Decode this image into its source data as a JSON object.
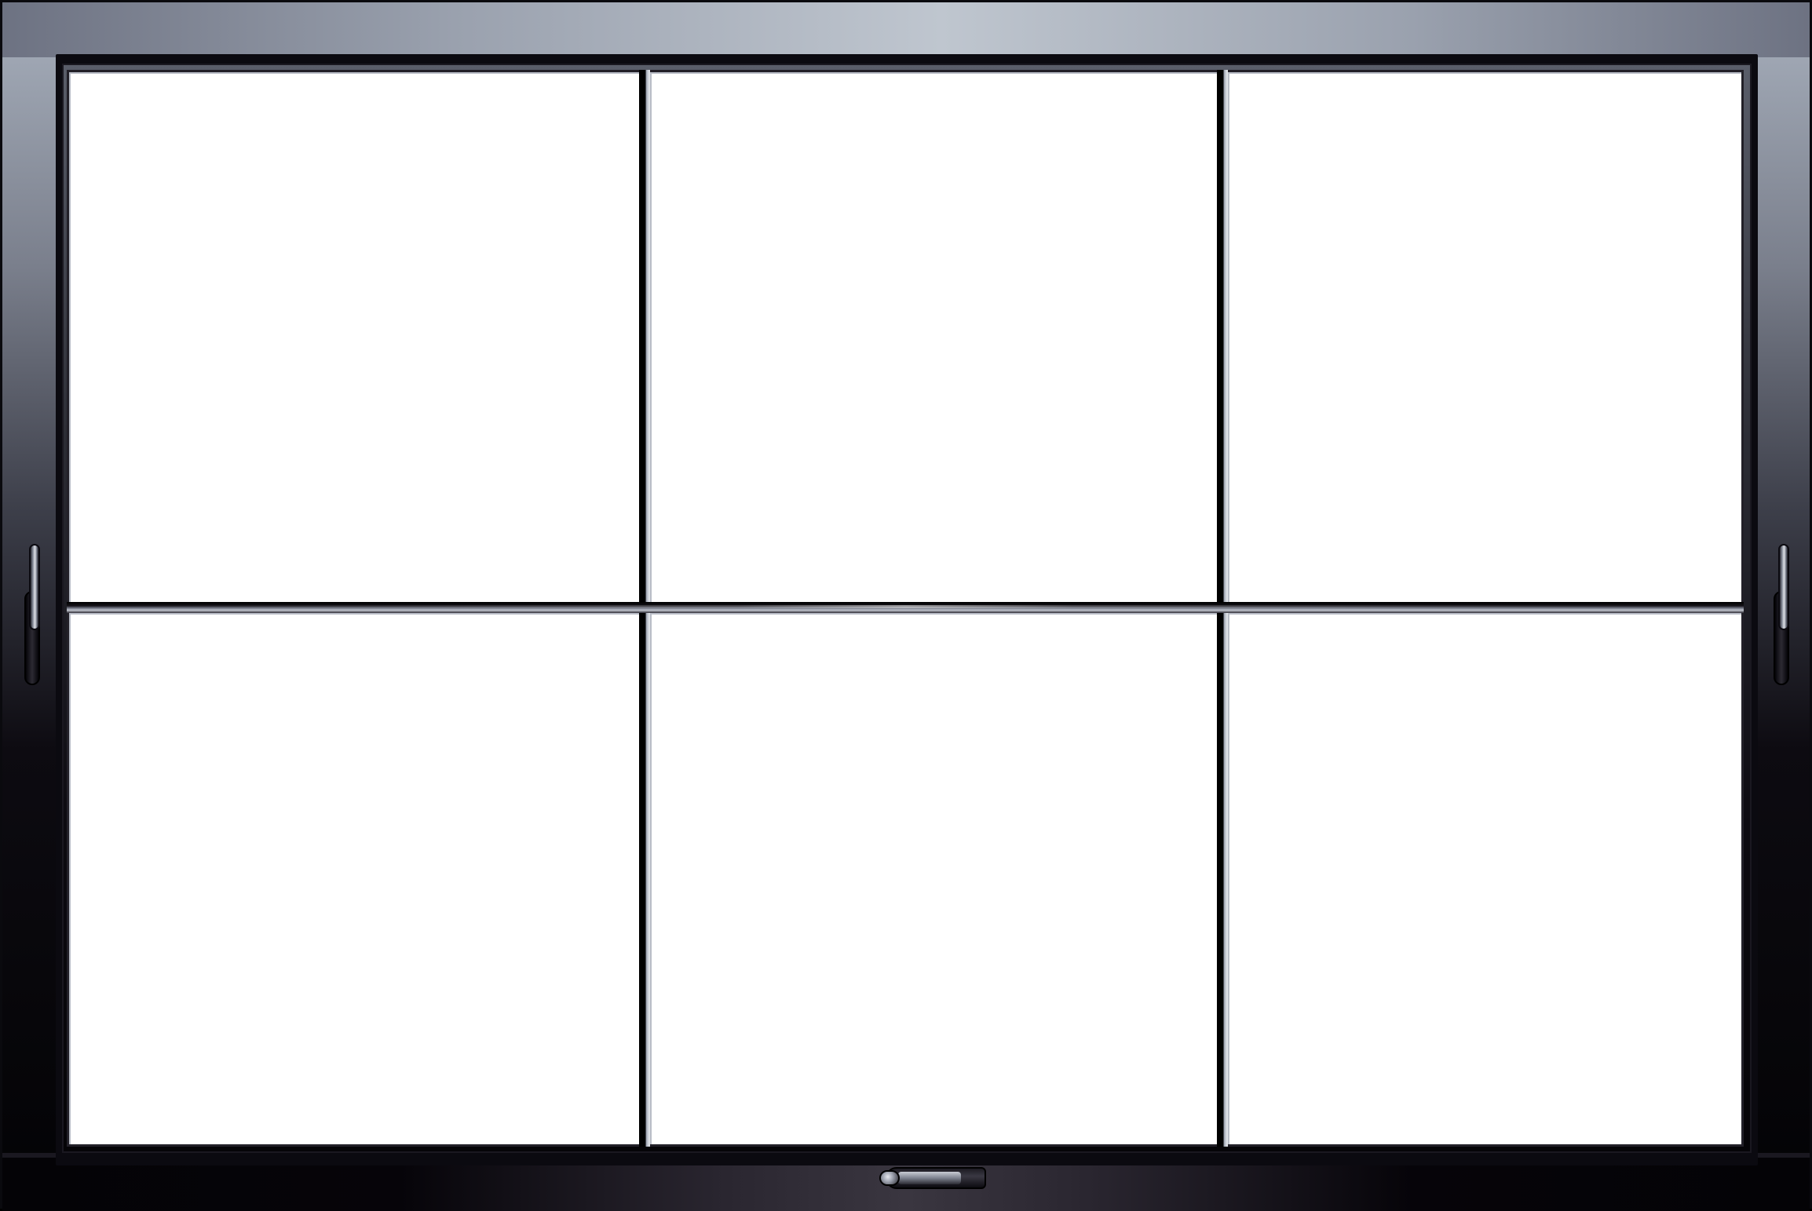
{
  "scene": {
    "subject": "",
    "panes": [
      {
        "row": 1,
        "col": 1
      },
      {
        "row": 1,
        "col": 2
      },
      {
        "row": 1,
        "col": 3
      },
      {
        "row": 2,
        "col": 1
      },
      {
        "row": 2,
        "col": 2
      },
      {
        "row": 2,
        "col": 3
      }
    ],
    "colors": {
      "frame_top": "#bfc6cf",
      "frame_bottom": "#030305",
      "glass": "#ffffff",
      "muntin": "#000000"
    },
    "icons": [
      "left-handle-icon",
      "right-handle-icon",
      "bottom-latch-icon"
    ]
  }
}
